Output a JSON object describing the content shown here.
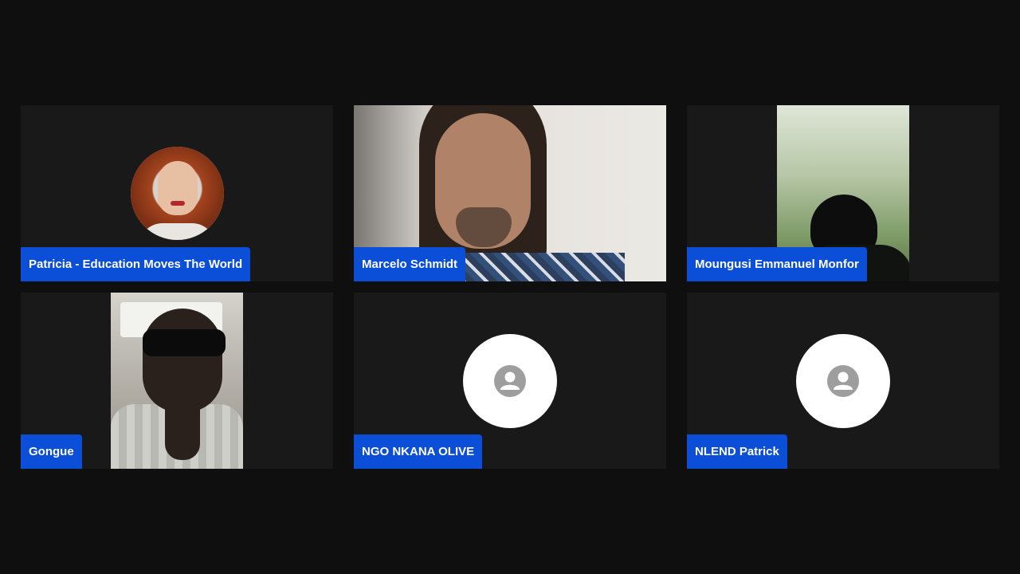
{
  "participants": [
    {
      "name": "Patricia - Education Moves The World",
      "view": "avatar-photo"
    },
    {
      "name": "Marcelo Schmidt",
      "view": "video"
    },
    {
      "name": "Moungusi Emmanuel Monfor",
      "view": "video"
    },
    {
      "name": "Gongue",
      "view": "video"
    },
    {
      "name": "NGO NKANA OLIVE",
      "view": "default-avatar",
      "icon": "person-icon"
    },
    {
      "name": "NLEND Patrick",
      "view": "default-avatar",
      "icon": "person-icon"
    }
  ],
  "colors": {
    "background": "#0f0f0f",
    "tile": "#191919",
    "name_label": "#0b4ed8",
    "name_text": "#ffffff",
    "default_avatar": "#ffffff",
    "avatar_icon": "#9e9e9e"
  }
}
